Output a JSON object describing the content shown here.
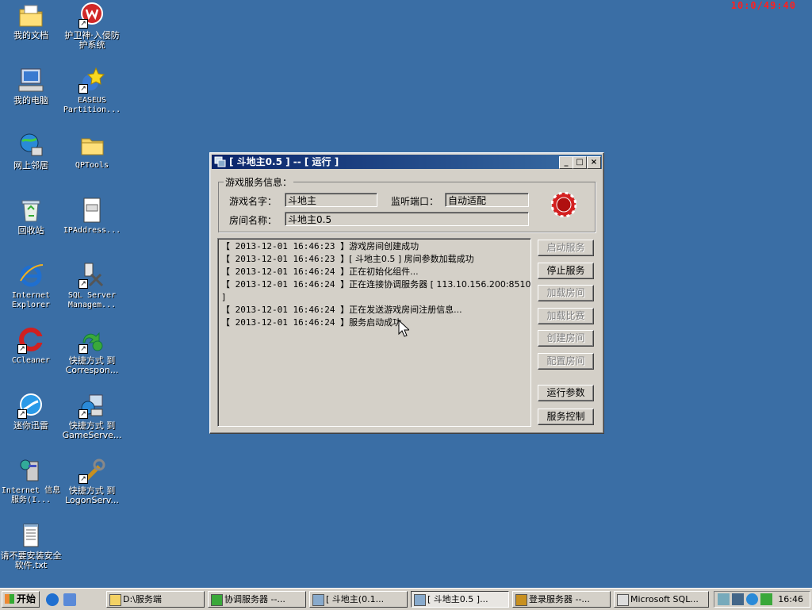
{
  "clock": "10:0/49:40",
  "desktop_icons": [
    {
      "label": "我的文档",
      "icon": "folder-documents-icon"
    },
    {
      "label": "护卫神·入侵防护系统",
      "icon": "shield-w-icon"
    },
    {
      "label": "我的电脑",
      "icon": "computer-icon"
    },
    {
      "label": "EASEUS Partition...",
      "icon": "partition-star-icon"
    },
    {
      "label": "网上邻居",
      "icon": "network-icon"
    },
    {
      "label": "QPTools",
      "icon": "folder-icon"
    },
    {
      "label": "回收站",
      "icon": "recycle-bin-icon"
    },
    {
      "label": "IPAddress...",
      "icon": "text-file-icon"
    },
    {
      "label": "Internet Explorer",
      "icon": "ie-icon"
    },
    {
      "label": "SQL Server Managem...",
      "icon": "sql-tools-icon"
    },
    {
      "label": "CCleaner",
      "icon": "ccleaner-icon"
    },
    {
      "label": "快捷方式 到 Correspon...",
      "icon": "shortcut-green-icon"
    },
    {
      "label": "迷你迅雷",
      "icon": "thunder-icon"
    },
    {
      "label": "快捷方式 到 GameServe...",
      "icon": "shortcut-server-icon"
    },
    {
      "label": "Internet 信息服务(I...",
      "icon": "iis-icon"
    },
    {
      "label": "快捷方式 到 LogonServ...",
      "icon": "shortcut-tools-icon"
    },
    {
      "label": "请不要安装安全软件.txt",
      "icon": "notepad-icon"
    }
  ],
  "window": {
    "title": "[ 斗地主0.5 ] -- [ 运行 ]",
    "controls": {
      "minimize": "_",
      "maximize": "□",
      "close": "×"
    },
    "group_title": "游戏服务信息：",
    "game_name_label": "游戏名字：",
    "game_name_value": "斗地主",
    "listen_port_label": "监听端口：",
    "listen_port_value": "自动适配",
    "room_name_label": "房间名称：",
    "room_name_value": "斗地主0.5",
    "log": [
      {
        "ts": "【 2013-12-01 16:46:23 】",
        "msg": "游戏房间创建成功"
      },
      {
        "ts": "【 2013-12-01 16:46:23 】",
        "msg": "[ 斗地主0.5 ] 房间参数加载成功"
      },
      {
        "ts": "【 2013-12-01 16:46:24 】",
        "msg": "正在初始化组件..."
      },
      {
        "ts": "【 2013-12-01 16:46:24 】",
        "msg": "正在连接协调服务器 [ 113.10.156.200:8510"
      },
      {
        "ts": "]",
        "msg": ""
      },
      {
        "ts": "【 2013-12-01 16:46:24 】",
        "msg": "正在发送游戏房间注册信息..."
      },
      {
        "ts": "【 2013-12-01 16:46:24 】",
        "msg": "服务启动成功"
      }
    ],
    "buttons": {
      "start": "启动服务",
      "stop": "停止服务",
      "load_room": "加载房间",
      "load_match": "加载比赛",
      "create_room": "创建房间",
      "config_room": "配置房间",
      "run_params": "运行参数",
      "service_control": "服务控制"
    }
  },
  "taskbar": {
    "start_label": "开始",
    "tasks": [
      {
        "label": "D:\\服务端"
      },
      {
        "label": "协调服务器 --..."
      },
      {
        "label": "[ 斗地主(0.1..."
      },
      {
        "label": "[ 斗地主0.5 ]..."
      },
      {
        "label": "登录服务器 --..."
      },
      {
        "label": "Microsoft SQL..."
      }
    ],
    "time": "16:46"
  }
}
